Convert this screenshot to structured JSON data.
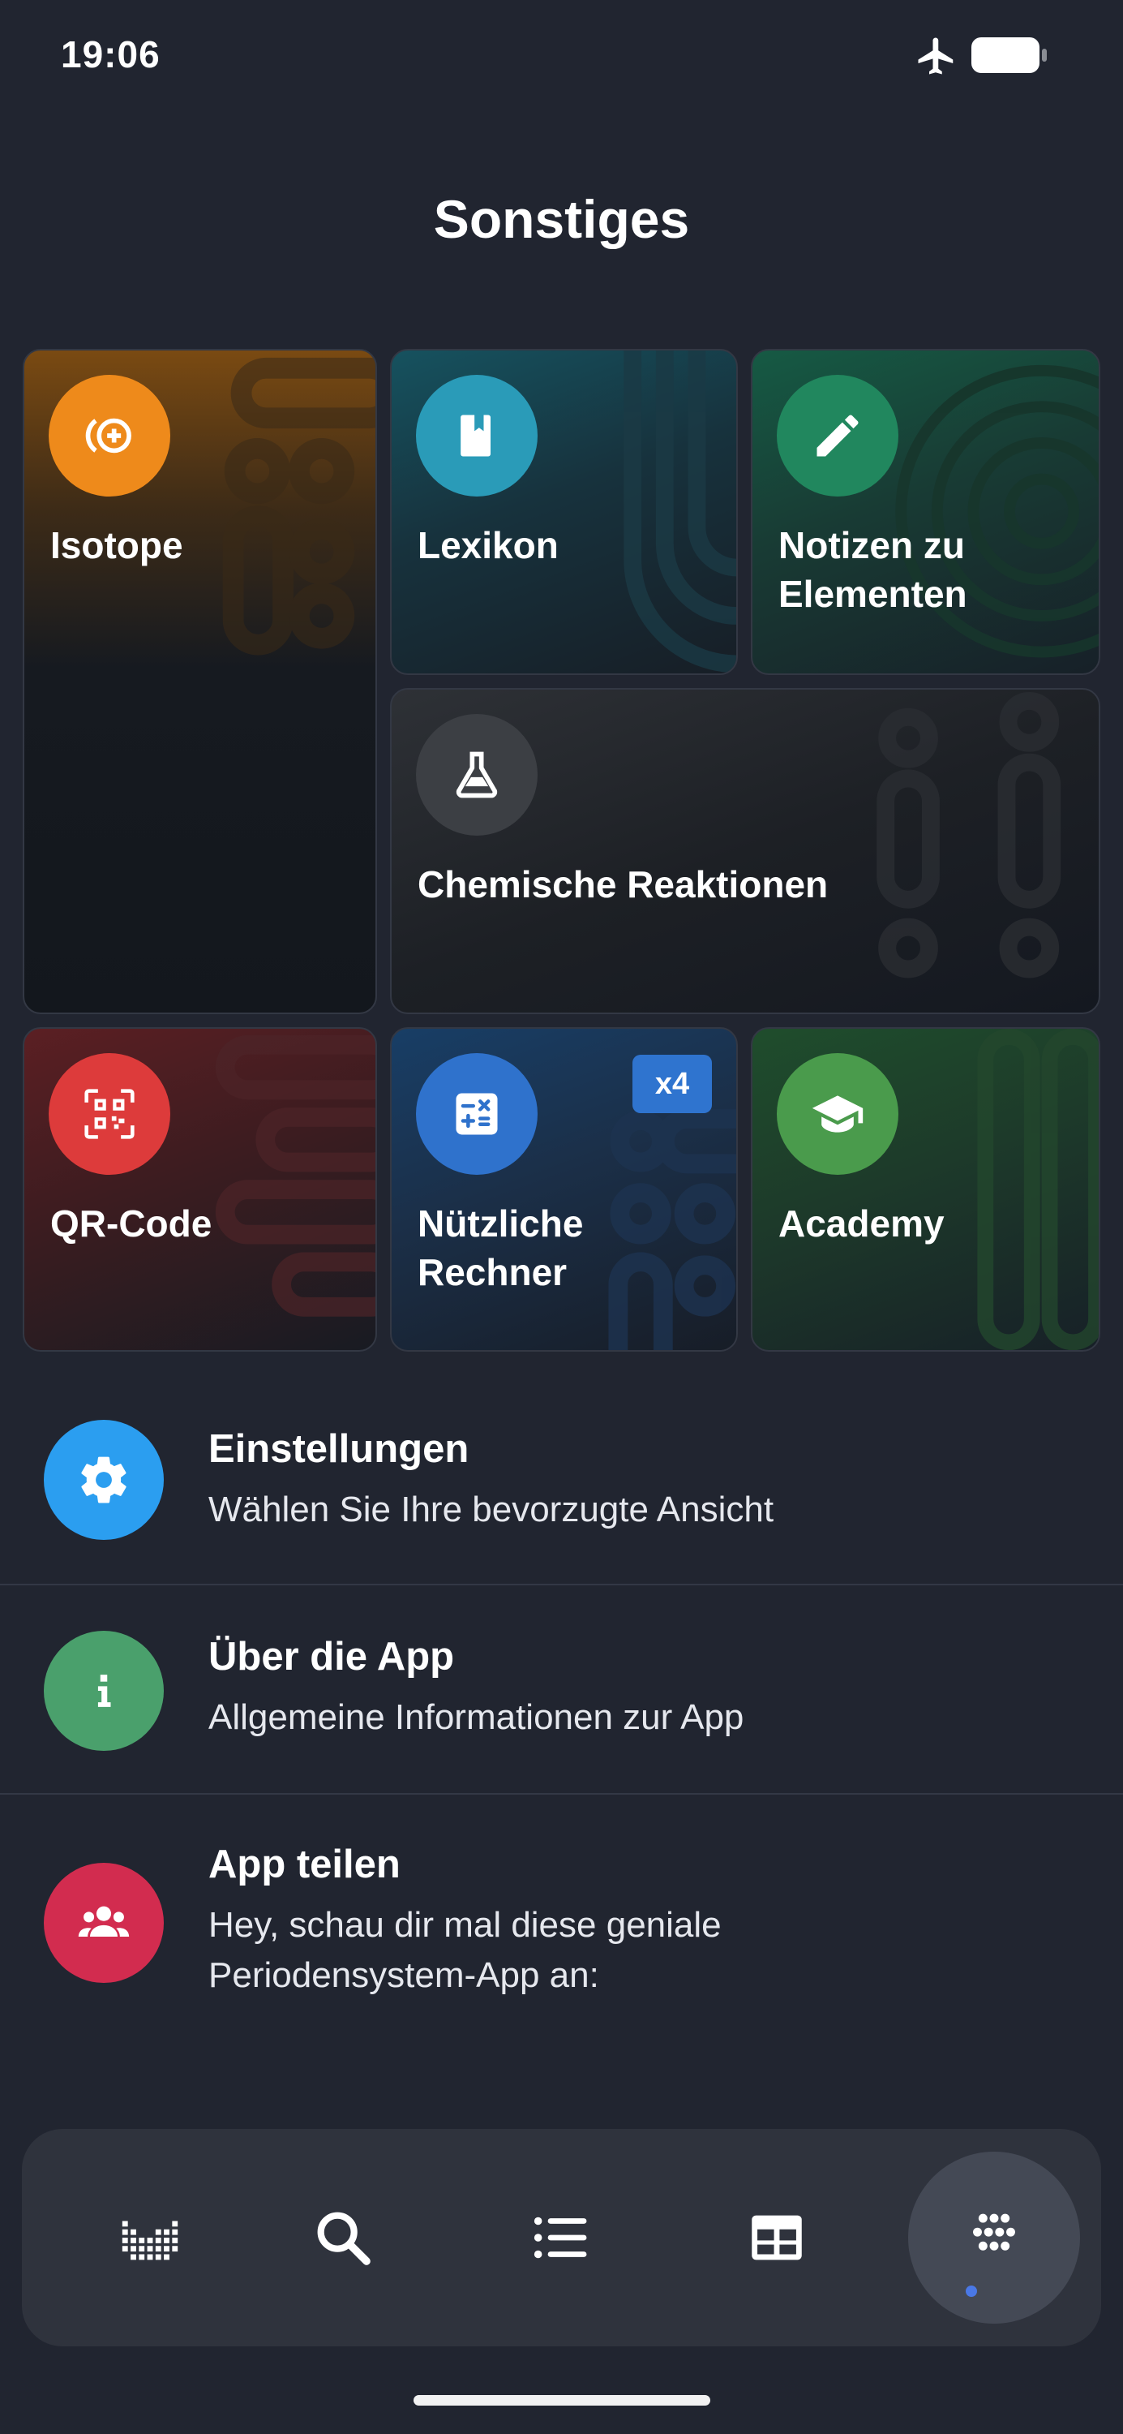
{
  "status_bar": {
    "time": "19:06"
  },
  "page": {
    "title": "Sonstiges"
  },
  "tiles": {
    "isotope": {
      "label": "Isotope",
      "icon": "isotope-icon",
      "color": "#ee8a1b"
    },
    "lexikon": {
      "label": "Lexikon",
      "icon": "book-icon",
      "color": "#2a9bb8"
    },
    "notizen": {
      "label_line1": "Notizen zu",
      "label_line2": "Elementen",
      "icon": "pencil-icon",
      "color": "#21875e"
    },
    "reaktionen": {
      "label": "Chemische Reaktionen",
      "icon": "flask-icon",
      "color": "#3c3f44"
    },
    "qr": {
      "label": "QR-Code",
      "icon": "qr-code-icon",
      "color": "#dd3b3b"
    },
    "rechner": {
      "label_line1": "Nützliche",
      "label_line2": "Rechner",
      "badge": "x4",
      "icon": "calculator-icon",
      "color": "#2f72cc"
    },
    "academy": {
      "label": "Academy",
      "icon": "graduation-cap-icon",
      "color": "#4a9b4c"
    }
  },
  "list": [
    {
      "title": "Einstellungen",
      "subtitle": "Wählen Sie Ihre bevorzugte Ansicht",
      "icon": "gear-icon",
      "color": "#2b9ef0"
    },
    {
      "title": "Über die App",
      "subtitle": "Allgemeine Informationen zur App",
      "icon": "info-icon",
      "color": "#4aa06c"
    },
    {
      "title": "App teilen",
      "subtitle": "Hey, schau dir mal diese geniale Periodensystem-App an:",
      "icon": "users-icon",
      "color": "#d22c4f"
    }
  ],
  "bottom_nav": {
    "items": [
      "periodic-chart-icon",
      "search-icon",
      "list-icon",
      "table-icon",
      "dots-icon"
    ],
    "active": "dots-icon"
  }
}
